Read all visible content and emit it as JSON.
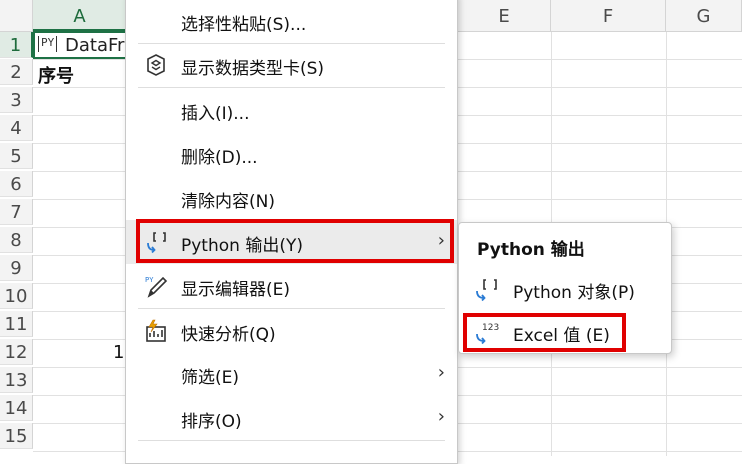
{
  "sheet": {
    "columns": [
      "A",
      "E",
      "F",
      "G"
    ],
    "rows": [
      "1",
      "2",
      "3",
      "4",
      "5",
      "6",
      "7",
      "8",
      "9",
      "10",
      "11",
      "12",
      "13",
      "14",
      "15"
    ],
    "cells": {
      "a1": "DataFr",
      "a1_badge": "PY",
      "a2": "序号",
      "a12": "1"
    }
  },
  "context_menu": {
    "items": [
      {
        "label": "选择性粘贴(S)...",
        "icon": "none"
      },
      {
        "label": "显示数据类型卡(S)",
        "icon": "data-type-card-icon"
      },
      {
        "label": "插入(I)...",
        "icon": "none"
      },
      {
        "label": "删除(D)...",
        "icon": "none"
      },
      {
        "label": "清除内容(N)",
        "icon": "none"
      },
      {
        "label": "Python 输出(Y)",
        "icon": "python-output-icon",
        "submenu": true
      },
      {
        "label": "显示编辑器(E)",
        "icon": "python-editor-icon"
      },
      {
        "label": "快速分析(Q)",
        "icon": "quick-analysis-icon"
      },
      {
        "label": "筛选(E)",
        "icon": "none",
        "submenu": true
      },
      {
        "label": "排序(O)",
        "icon": "none",
        "submenu": true
      }
    ]
  },
  "submenu": {
    "title": "Python 输出",
    "items": [
      {
        "label": "Python 对象(P)",
        "icon": "python-object-icon"
      },
      {
        "label": "Excel 值 (E)",
        "icon": "excel-value-icon"
      }
    ]
  },
  "colors": {
    "excel_green": "#1e7145",
    "highlight_red": "#e00000",
    "icon_blue": "#2a7bd4"
  }
}
